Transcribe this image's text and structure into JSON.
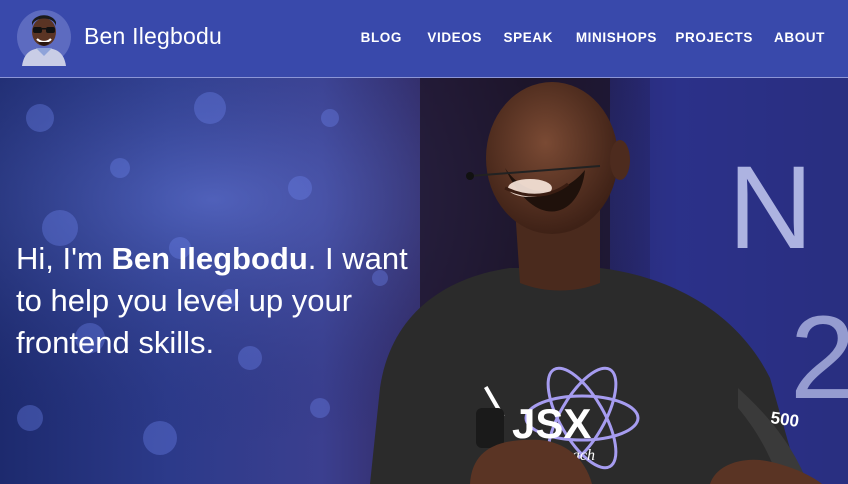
{
  "site": {
    "name": "Ben Ilegbodu"
  },
  "nav": {
    "items": [
      {
        "label": "BLOG"
      },
      {
        "label": "VIDEOS"
      },
      {
        "label": "SPEAK"
      },
      {
        "label": "MINISHOPS"
      },
      {
        "label": "PROJECTS"
      },
      {
        "label": "ABOUT"
      }
    ]
  },
  "hero": {
    "intro_prefix": "Hi, I'm ",
    "intro_name": "Ben Ilegbodu",
    "intro_suffix": ". I want to help you level up your frontend skills.",
    "shirt_text": "JSX",
    "shirt_subtext": "Beach",
    "sleeve_text": "500",
    "backdrop_letters": [
      "N",
      "2"
    ]
  },
  "colors": {
    "header_bg": "#3949ab",
    "header_border": "#8c95d6",
    "text": "#ffffff",
    "shirt": "#2b2b2b",
    "skin": "#5a3424"
  },
  "icons": {
    "avatar": "cartoon-avatar-with-sunglasses"
  }
}
